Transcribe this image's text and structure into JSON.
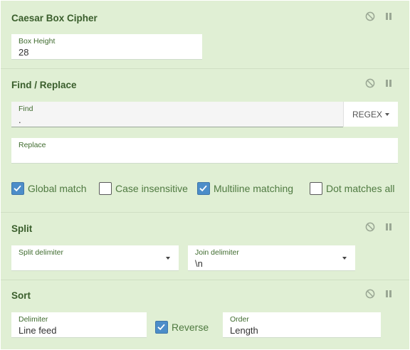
{
  "operations": [
    {
      "title": "Caesar Box Cipher",
      "fields": {
        "box_height": {
          "label": "Box Height",
          "value": "28"
        }
      },
      "controls": {
        "disable_icon": "disable-icon",
        "breakpoint_icon": "pause-icon"
      }
    },
    {
      "title": "Find / Replace",
      "fields": {
        "find": {
          "label": "Find",
          "value": "."
        },
        "find_mode": "REGEX",
        "replace": {
          "label": "Replace",
          "value": ""
        }
      },
      "checkboxes": [
        {
          "label": "Global match",
          "checked": true
        },
        {
          "label": "Case insensitive",
          "checked": false
        },
        {
          "label": "Multiline matching",
          "checked": true
        },
        {
          "label": "Dot matches all",
          "checked": false
        }
      ],
      "controls": {
        "disable_icon": "disable-icon",
        "breakpoint_icon": "pause-icon"
      }
    },
    {
      "title": "Split",
      "fields": {
        "split_delimiter": {
          "label": "Split delimiter",
          "value": ""
        },
        "join_delimiter": {
          "label": "Join delimiter",
          "value": "\\n"
        }
      },
      "controls": {
        "disable_icon": "disable-icon",
        "breakpoint_icon": "pause-icon"
      }
    },
    {
      "title": "Sort",
      "fields": {
        "delimiter": {
          "label": "Delimiter",
          "value": "Line feed"
        },
        "reverse": {
          "label": "Reverse",
          "checked": true
        },
        "order": {
          "label": "Order",
          "value": "Length"
        }
      },
      "controls": {
        "disable_icon": "disable-icon",
        "breakpoint_icon": "pause-icon"
      }
    }
  ],
  "colors": {
    "operation_bg": "#e0efd4",
    "title_green": "#3a5e2c",
    "label_green": "#3f6b2e",
    "checkbox_blue": "#4c8dc9"
  }
}
